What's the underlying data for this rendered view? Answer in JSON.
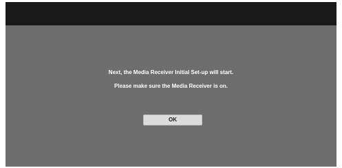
{
  "dialog": {
    "line1": "Next, the Media Receiver Initial Set-up will start.",
    "line2": "Please make sure the Media Receiver is on.",
    "ok_label": "OK"
  },
  "colors": {
    "screen_background": "#6d6d6d",
    "top_bar": "#1a1a1a",
    "text": "#ffffff",
    "button_background": "#dcdcdc"
  }
}
